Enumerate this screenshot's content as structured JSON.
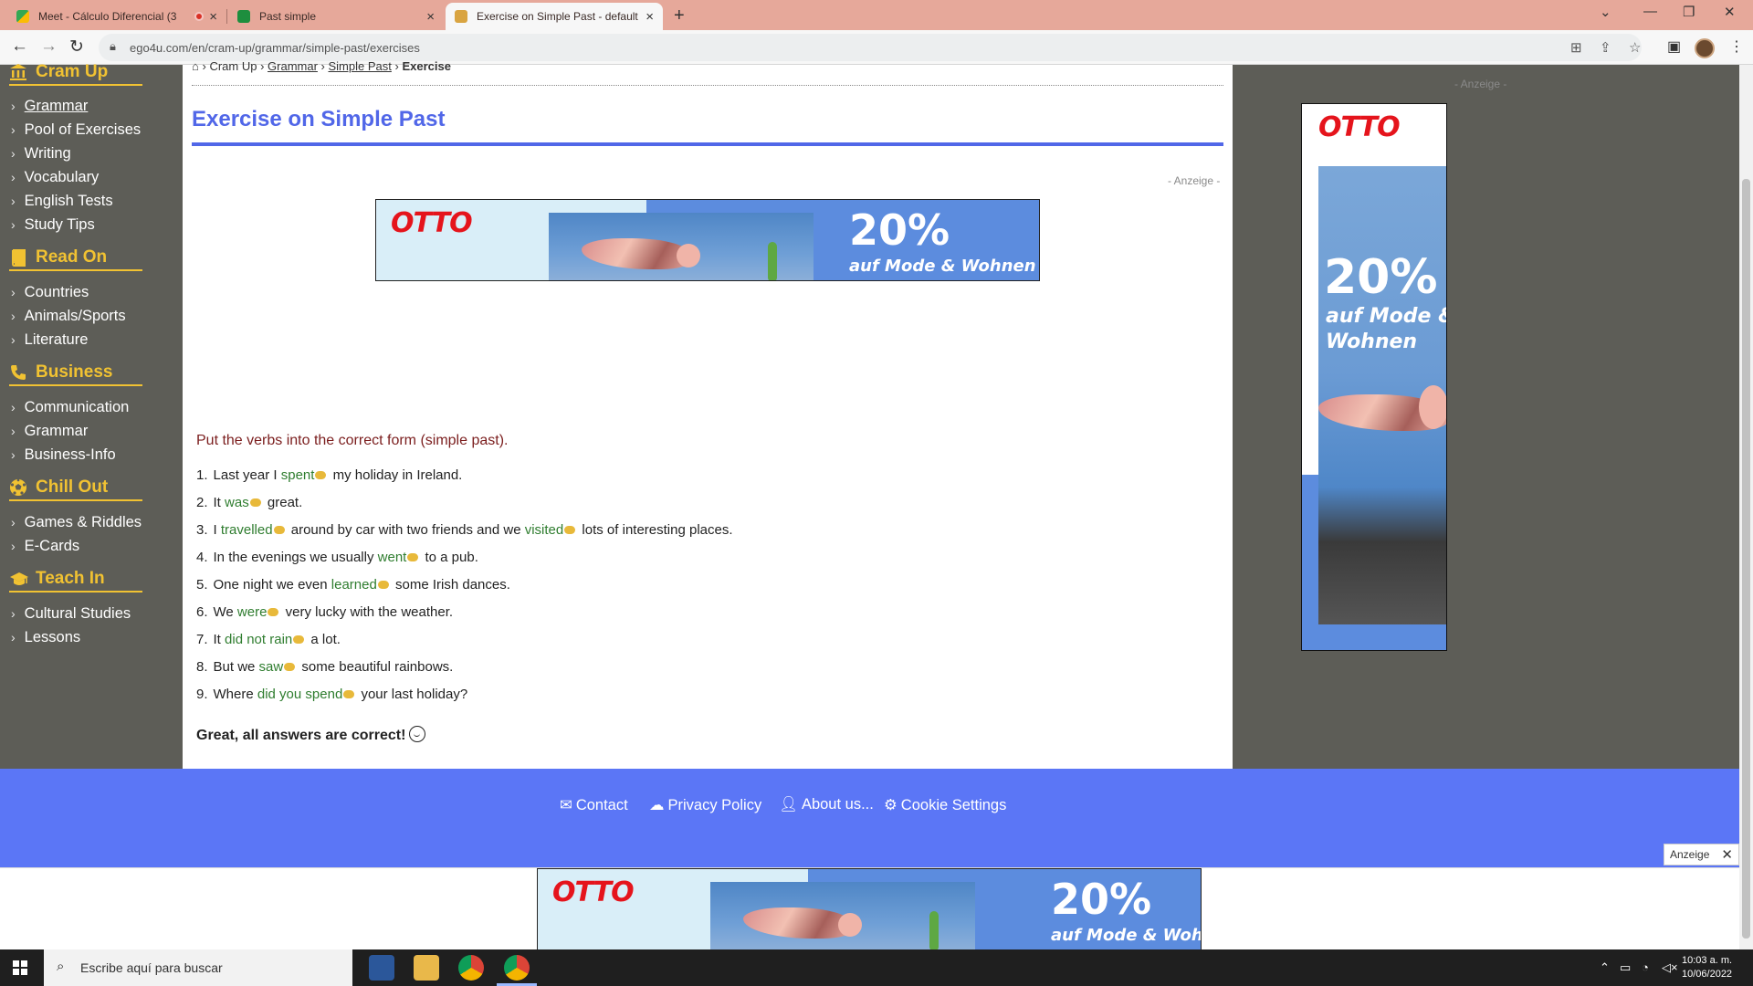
{
  "browser": {
    "tabs": [
      {
        "label": "Meet - Cálculo Diferencial (3",
        "close": "×"
      },
      {
        "label": "Past simple",
        "close": "×"
      },
      {
        "label": "Exercise on Simple Past - default",
        "close": "×"
      }
    ],
    "new_tab": "+",
    "url": "ego4u.com/en/cram-up/grammar/simple-past/exercises"
  },
  "sidebar": {
    "sections": [
      {
        "title": "Cram Up",
        "items": [
          "Grammar",
          "Pool of Exercises",
          "Writing",
          "Vocabulary",
          "English Tests",
          "Study Tips"
        ]
      },
      {
        "title": "Read On",
        "items": [
          "Countries",
          "Animals/Sports",
          "Literature"
        ]
      },
      {
        "title": "Business",
        "items": [
          "Communication",
          "Grammar",
          "Business-Info"
        ]
      },
      {
        "title": "Chill Out",
        "items": [
          "Games & Riddles",
          "E-Cards"
        ]
      },
      {
        "title": "Teach In",
        "items": [
          "Cultural Studies",
          "Lessons"
        ]
      }
    ]
  },
  "breadcrumb": {
    "home": "⌂",
    "cram_up": "Cram Up",
    "grammar": "Grammar",
    "simple_past": "Simple Past",
    "current": "Exercise"
  },
  "page_title": "Exercise on Simple Past",
  "ad_label": "- Anzeige -",
  "ad": {
    "brand": "OTTO",
    "percent": "20%",
    "tagline_line1": "auf Mode &",
    "tagline_line2": "Wohnen",
    "tagline_full": "auf Mode & Wohnen",
    "tagline_cut": "auf Mode & Woh"
  },
  "instruction": "Put the verbs into the correct form (simple past).",
  "exercises": [
    {
      "num": "1.",
      "pre": "Last year I",
      "answer": "spent",
      "post": "my holiday in Ireland."
    },
    {
      "num": "2.",
      "pre": "It",
      "answer": "was",
      "post": "great."
    },
    {
      "num": "3.",
      "pre": "I",
      "answer": "travelled",
      "mid": "around by car with two friends and we",
      "answer2": "visited",
      "post": "lots of interesting places."
    },
    {
      "num": "4.",
      "pre": "In the evenings we usually",
      "answer": "went",
      "post": "to a pub."
    },
    {
      "num": "5.",
      "pre": "One night we even",
      "answer": "learned",
      "post": "some Irish dances."
    },
    {
      "num": "6.",
      "pre": "We",
      "answer": "were",
      "post": "very lucky with the weather."
    },
    {
      "num": "7.",
      "pre": "It",
      "answer": "did not rain",
      "post": "a lot."
    },
    {
      "num": "8.",
      "pre": "But we",
      "answer": "saw",
      "post": "some beautiful rainbows."
    },
    {
      "num": "9.",
      "pre": "Where",
      "answer": "did you spend",
      "post": "your last holiday?"
    }
  ],
  "result": "Great, all answers are correct!",
  "footer": {
    "contact": "Contact",
    "privacy": "Privacy Policy",
    "about": "About us...",
    "cookies": "Cookie Settings"
  },
  "anzeige_close": "Anzeige",
  "taskbar": {
    "search_placeholder": "Escribe aquí para buscar",
    "time": "10:03 a. m.",
    "date": "10/06/2022"
  },
  "colors": {
    "accent_blue": "#5167e8",
    "footer_blue": "#5b76f6",
    "sidebar_bg": "#5d5d57",
    "sidebar_heading": "#f1c232",
    "answer_green": "#2f7d2f",
    "instruction_red": "#7b1e1e",
    "tab_bar": "#e6a89a"
  }
}
